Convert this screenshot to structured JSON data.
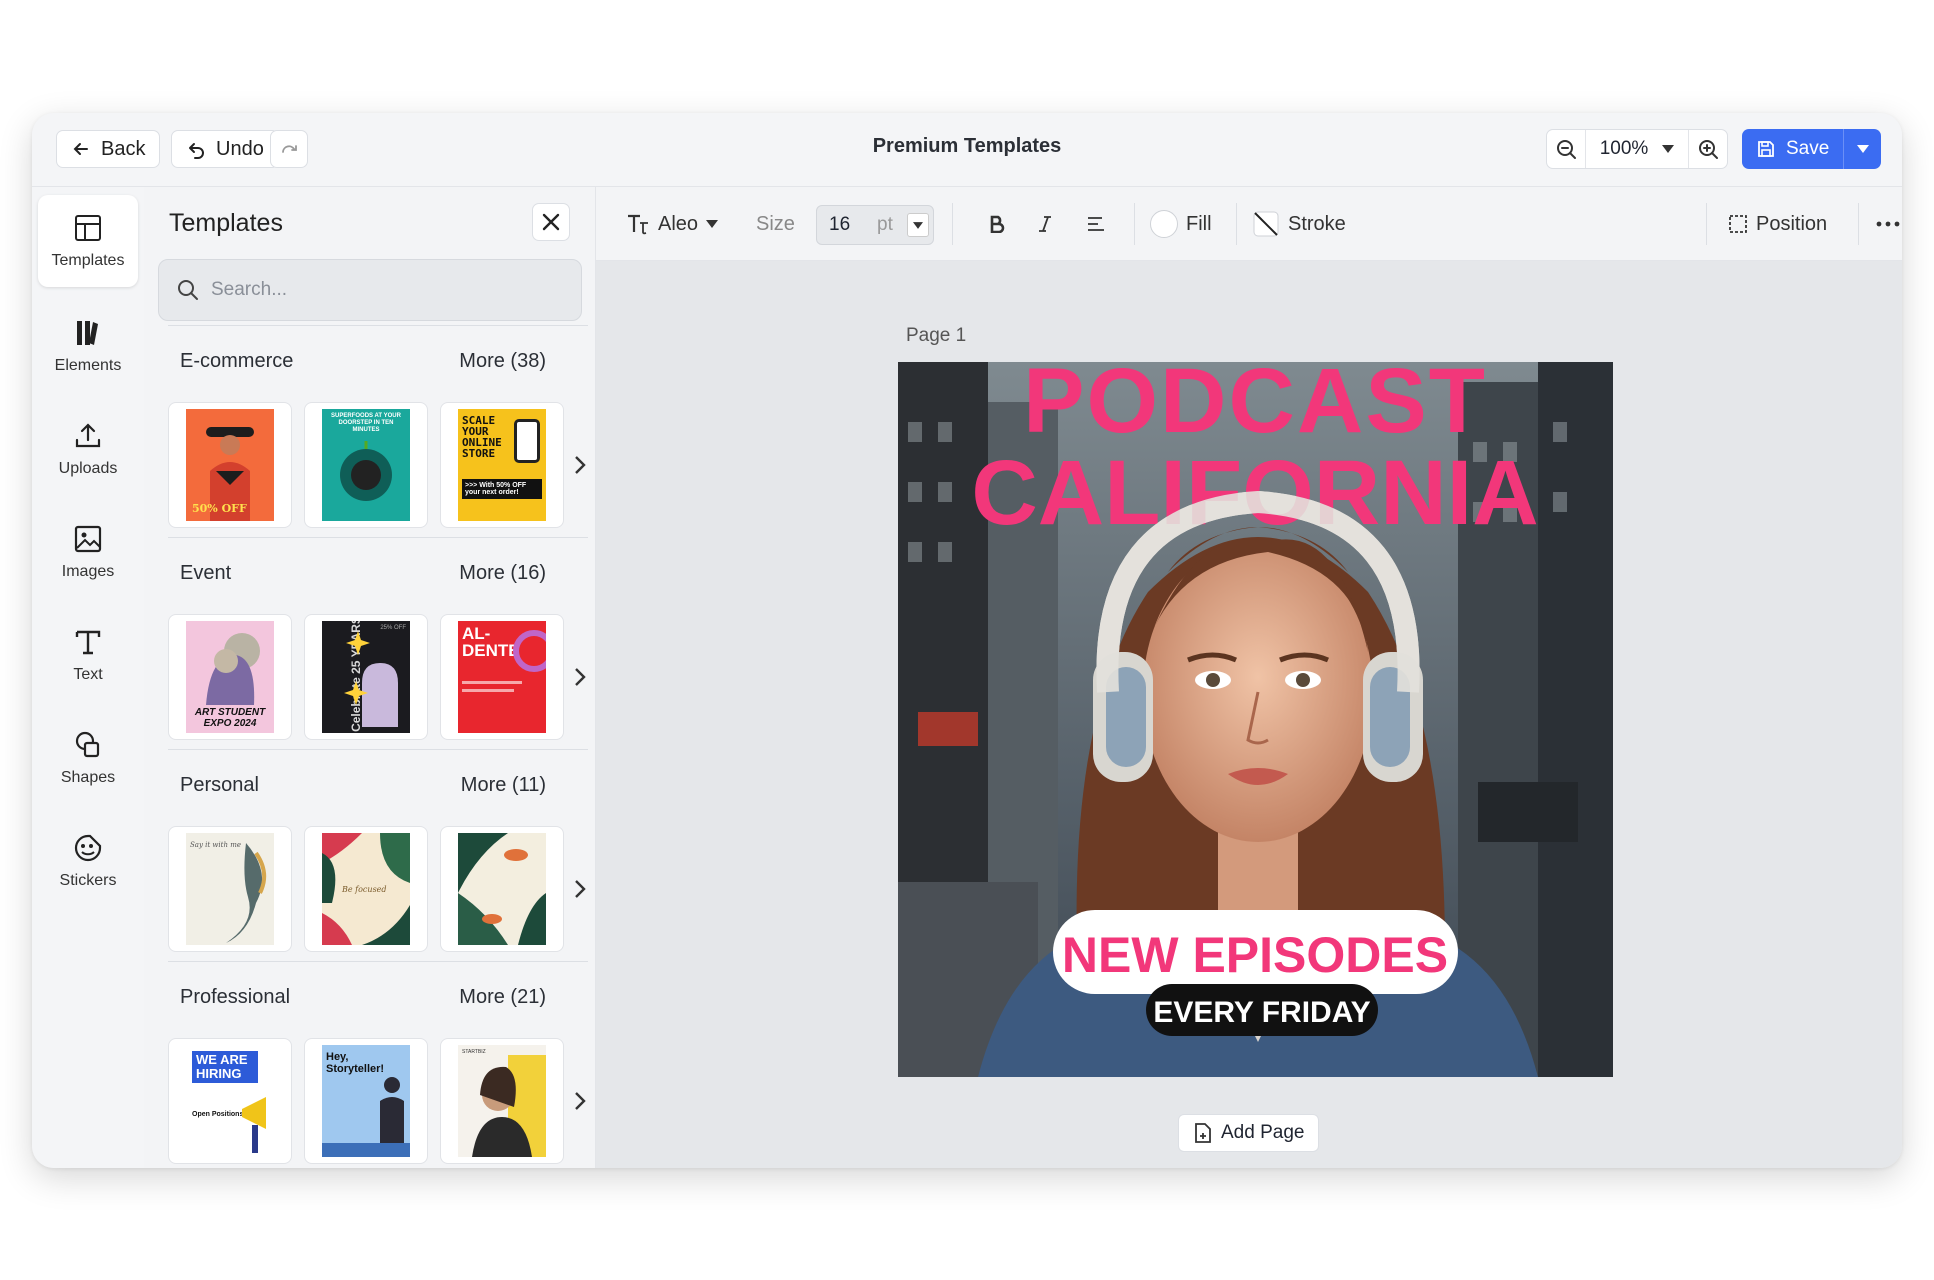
{
  "topbar": {
    "back_label": "Back",
    "undo_label": "Undo",
    "title": "Premium Templates",
    "zoom_value": "100%",
    "save_label": "Save"
  },
  "rail": {
    "items": [
      {
        "label": "Templates",
        "icon": "templates-icon",
        "active": true
      },
      {
        "label": "Elements",
        "icon": "elements-icon"
      },
      {
        "label": "Uploads",
        "icon": "upload-icon"
      },
      {
        "label": "Images",
        "icon": "image-icon"
      },
      {
        "label": "Text",
        "icon": "text-icon"
      },
      {
        "label": "Shapes",
        "icon": "shapes-icon"
      },
      {
        "label": "Stickers",
        "icon": "sticker-icon"
      }
    ]
  },
  "panel": {
    "title": "Templates",
    "search_placeholder": "Search...",
    "sections": [
      {
        "name": "E-commerce",
        "more": "More (38)",
        "thumbs": [
          {
            "bg": "#f36b3c",
            "text": "50% OFF"
          },
          {
            "bg": "#1aa89c",
            "text": "SUPERFOODS AT YOUR DOORSTEP IN TEN MINUTES"
          },
          {
            "bg": "#f6c21c",
            "text": "SCALE YOUR ONLINE STORE",
            "sub": ">>> With 50% OFF your next order!"
          }
        ]
      },
      {
        "name": "Event",
        "more": "More (16)",
        "thumbs": [
          {
            "bg": "#f3c6dd",
            "text": "ART STUDENT EXPO 2024"
          },
          {
            "bg": "#1b1b1f",
            "text": "Celebrate 25 YEARS",
            "sub": "25% OFF"
          },
          {
            "bg": "#e8262e",
            "text": "AL- DENTE"
          }
        ]
      },
      {
        "name": "Personal",
        "more": "More (11)",
        "thumbs": [
          {
            "bg": "#f1efe6",
            "text": "Say it with me"
          },
          {
            "bg": "#f5e9d1",
            "text": "Be focused"
          },
          {
            "bg": "#f3eedf",
            "text": ""
          }
        ]
      },
      {
        "name": "Professional",
        "more": "More (21)",
        "thumbs": [
          {
            "bg": "#ffffff",
            "text": "WE ARE HIRING",
            "sub": "Open Positions"
          },
          {
            "bg": "#9fc8ef",
            "text": "Hey, Storyteller!"
          },
          {
            "bg": "#f5f2ec",
            "text": "STARTBIZ"
          }
        ]
      }
    ]
  },
  "toolbar": {
    "font": "Aleo",
    "size_label": "Size",
    "size_value": "16",
    "size_unit": "pt",
    "fill_label": "Fill",
    "stroke_label": "Stroke",
    "position_label": "Position"
  },
  "canvas": {
    "page_label": "Page  1",
    "add_page_label": "Add Page",
    "design": {
      "headline_1": "PODCAST",
      "headline_2": "CALIFORNIA",
      "pill_1": "NEW EPISODES",
      "pill_2": "EVERY FRIDAY",
      "accent_color": "#f2377a"
    }
  },
  "colors": {
    "accent": "#3b6cf2",
    "podcast_pink": "#f2377a"
  }
}
